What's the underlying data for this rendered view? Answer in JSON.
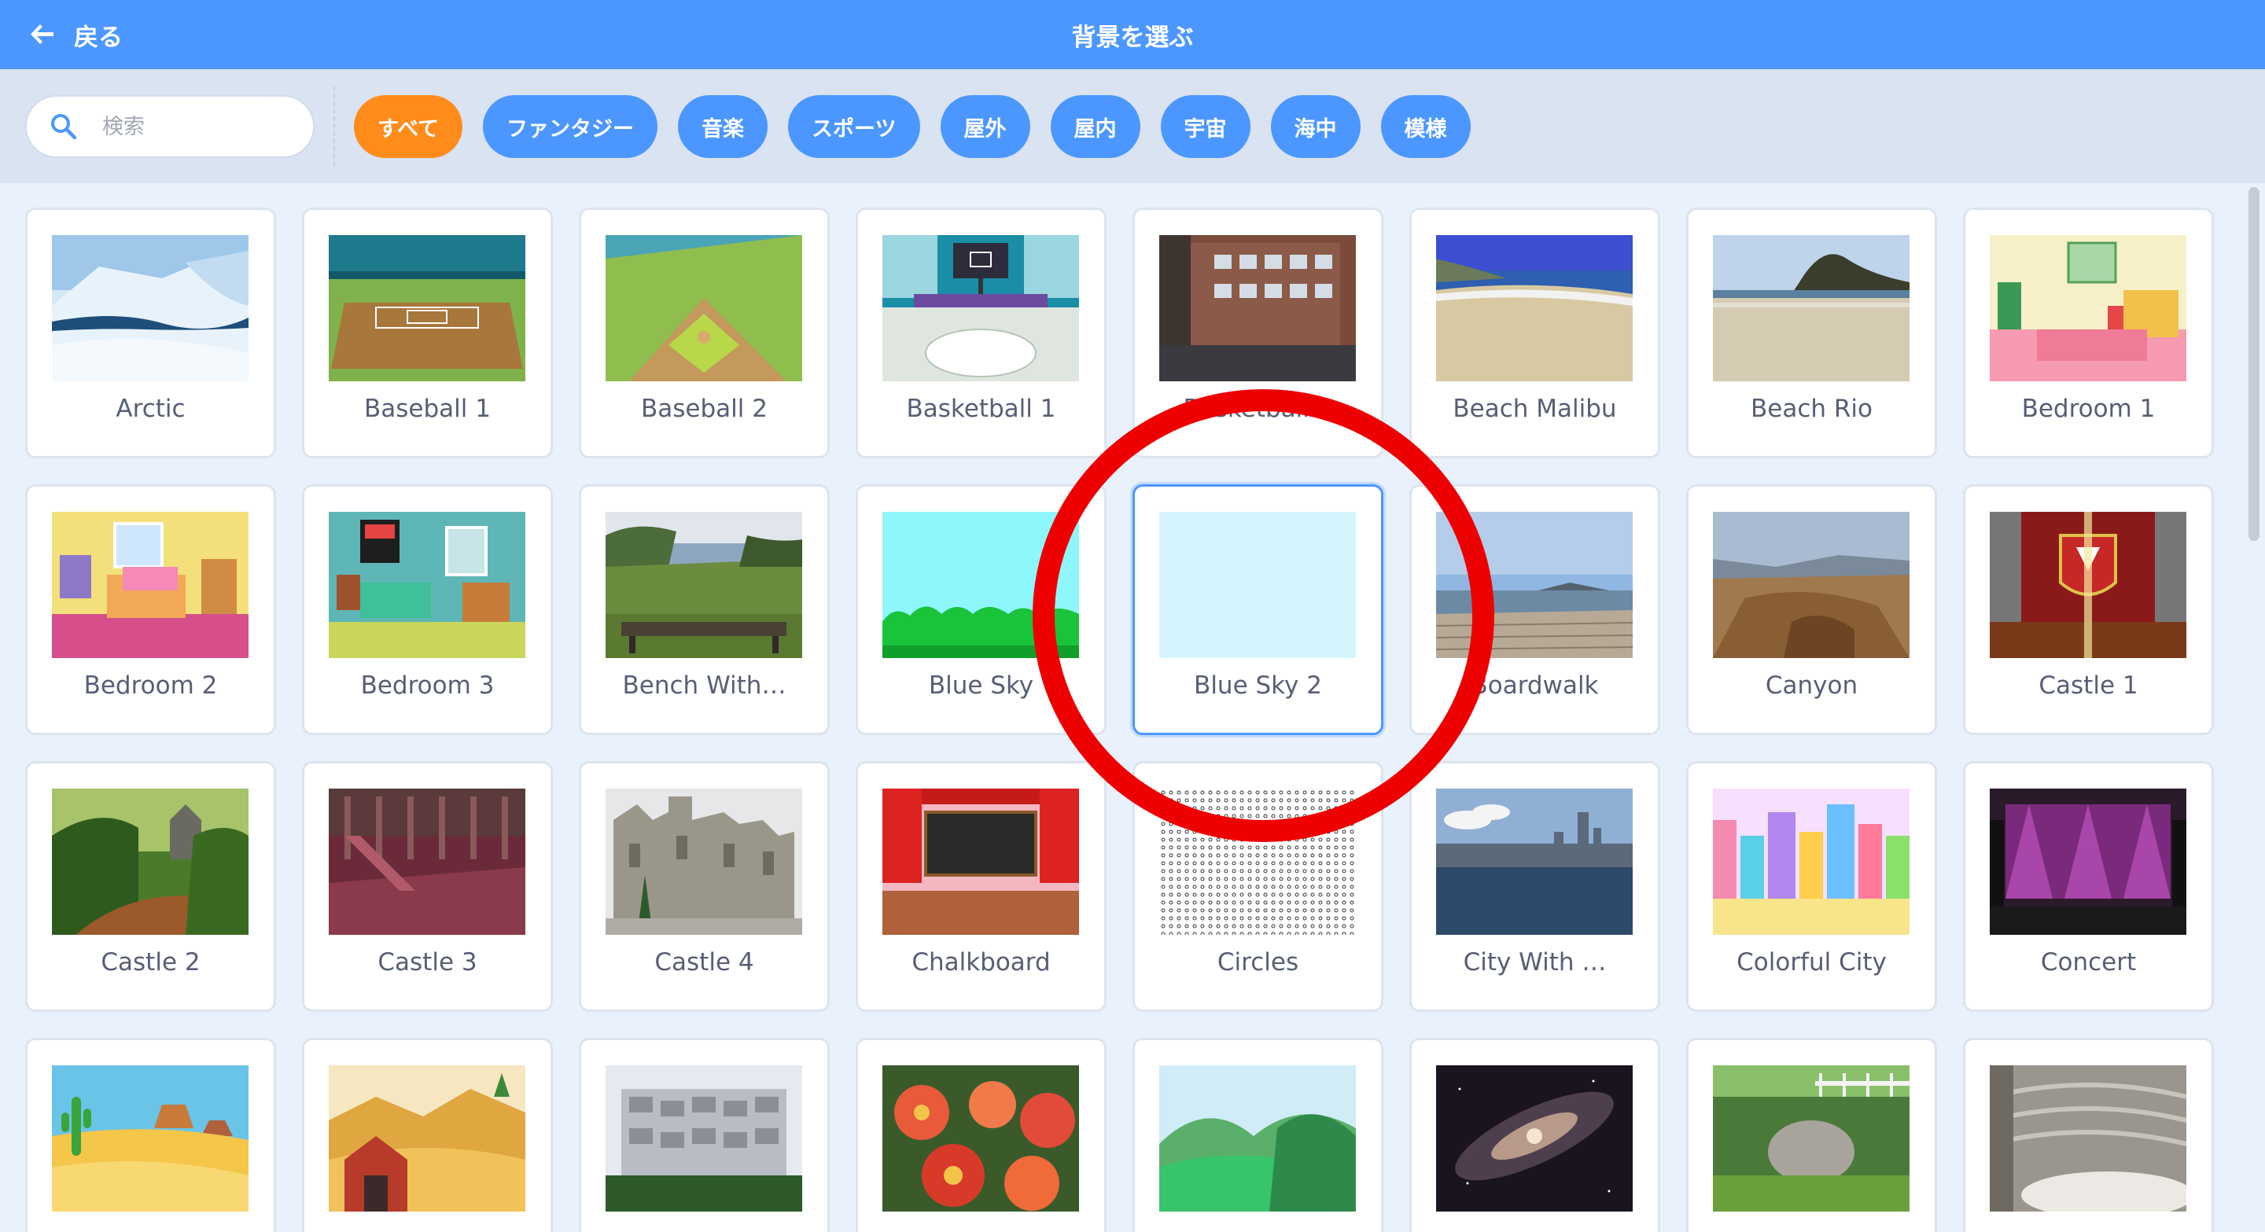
{
  "header": {
    "back_label": "戻る",
    "title": "背景を選ぶ"
  },
  "search": {
    "placeholder": "検索",
    "value": ""
  },
  "tags": [
    "すべて",
    "ファンタジー",
    "音楽",
    "スポーツ",
    "屋外",
    "屋内",
    "宇宙",
    "海中",
    "模様"
  ],
  "active_tag": "すべて",
  "backdrops": [
    {
      "name": "Arctic",
      "icon": "arctic-thumbnail"
    },
    {
      "name": "Baseball 1",
      "icon": "baseball-1-thumbnail"
    },
    {
      "name": "Baseball 2",
      "icon": "baseball-2-thumbnail"
    },
    {
      "name": "Basketball 1",
      "icon": "basketball-1-thumbnail"
    },
    {
      "name": "Basketball 2",
      "icon": "basketball-2-thumbnail"
    },
    {
      "name": "Beach Malibu",
      "icon": "beach-malibu-thumbnail"
    },
    {
      "name": "Beach Rio",
      "icon": "beach-rio-thumbnail"
    },
    {
      "name": "Bedroom 1",
      "icon": "bedroom-1-thumbnail"
    },
    {
      "name": "Bedroom 2",
      "icon": "bedroom-2-thumbnail"
    },
    {
      "name": "Bedroom 3",
      "icon": "bedroom-3-thumbnail"
    },
    {
      "name": "Bench With…",
      "icon": "bench-thumbnail"
    },
    {
      "name": "Blue Sky",
      "icon": "blue-sky-thumbnail"
    },
    {
      "name": "Blue Sky 2",
      "icon": "blue-sky-2-thumbnail"
    },
    {
      "name": "Boardwalk",
      "icon": "boardwalk-thumbnail"
    },
    {
      "name": "Canyon",
      "icon": "canyon-thumbnail"
    },
    {
      "name": "Castle 1",
      "icon": "castle-1-thumbnail"
    },
    {
      "name": "Castle 2",
      "icon": "castle-2-thumbnail"
    },
    {
      "name": "Castle 3",
      "icon": "castle-3-thumbnail"
    },
    {
      "name": "Castle 4",
      "icon": "castle-4-thumbnail"
    },
    {
      "name": "Chalkboard",
      "icon": "chalkboard-thumbnail"
    },
    {
      "name": "Circles",
      "icon": "circles-thumbnail"
    },
    {
      "name": "City With …",
      "icon": "city-thumbnail"
    },
    {
      "name": "Colorful City",
      "icon": "colorful-city-thumbnail"
    },
    {
      "name": "Concert",
      "icon": "concert-thumbnail"
    },
    {
      "name": "",
      "icon": "desert-thumbnail"
    },
    {
      "name": "",
      "icon": "farm-thumbnail"
    },
    {
      "name": "",
      "icon": "building-thumbnail"
    },
    {
      "name": "",
      "icon": "flowers-thumbnail"
    },
    {
      "name": "",
      "icon": "forest-thumbnail"
    },
    {
      "name": "",
      "icon": "galaxy-thumbnail"
    },
    {
      "name": "",
      "icon": "garden-rock-thumbnail"
    },
    {
      "name": "",
      "icon": "amphitheater-thumbnail"
    }
  ],
  "selected_backdrop": "Blue Sky 2",
  "colors": {
    "header": "#4c97ff",
    "active_tag": "#ff8c1a",
    "tag": "#4c97ff",
    "annotation": "#ee0000"
  }
}
